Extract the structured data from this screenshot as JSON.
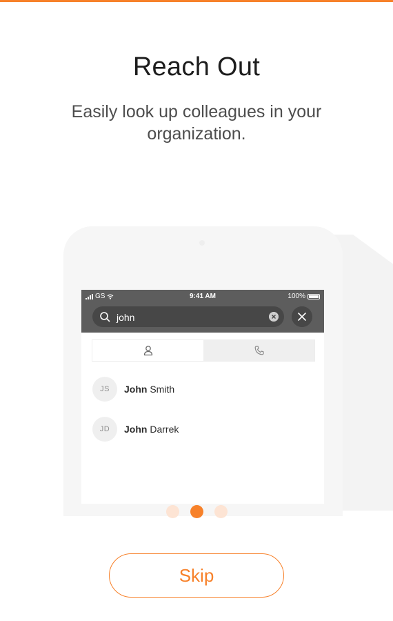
{
  "header": {
    "title": "Reach Out",
    "subtitle": "Easily look up colleagues in your organization."
  },
  "illustration": {
    "status_bar": {
      "carrier": "GS",
      "time": "9:41 AM",
      "battery": "100%"
    },
    "search": {
      "value": "john",
      "icon": "search-icon"
    },
    "tabs": [
      {
        "icon": "person-icon",
        "active": true
      },
      {
        "icon": "phone-icon",
        "active": false
      }
    ],
    "contacts": [
      {
        "initials": "JS",
        "match": "John",
        "rest": "Smith"
      },
      {
        "initials": "JD",
        "match": "John",
        "rest": "Darrek"
      }
    ]
  },
  "pagination": {
    "total": 3,
    "current": 2
  },
  "actions": {
    "skip_label": "Skip"
  },
  "colors": {
    "accent": "#f7812a",
    "dot_inactive": "#fde4d4",
    "status_bar": "#5d5d5d"
  }
}
